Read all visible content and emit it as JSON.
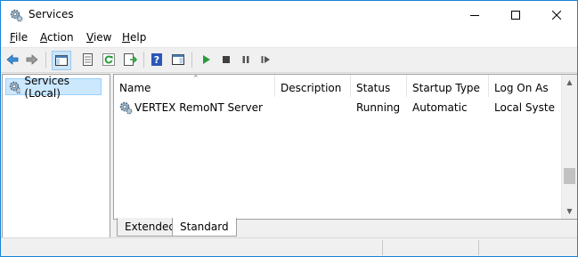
{
  "window": {
    "title": "Services"
  },
  "menu": [
    {
      "label": "File",
      "accel": "F",
      "rest": "ile"
    },
    {
      "label": "Action",
      "accel": "A",
      "rest": "ction"
    },
    {
      "label": "View",
      "accel": "V",
      "rest": "iew"
    },
    {
      "label": "Help",
      "accel": "H",
      "rest": "elp"
    }
  ],
  "toolbar": {
    "icons": [
      "back-icon",
      "forward-icon",
      "show-hide-console-tree-icon",
      "properties-icon",
      "refresh-icon",
      "export-list-icon",
      "help-icon",
      "show-action-pane-icon",
      "start-service-icon",
      "stop-service-icon",
      "pause-service-icon",
      "restart-service-icon"
    ]
  },
  "tree": {
    "root_label": "Services (Local)"
  },
  "list": {
    "columns": [
      "Name",
      "Description",
      "Status",
      "Startup Type",
      "Log On As"
    ],
    "rows": [
      {
        "name": "VERTEX RemoNT Server",
        "description": "",
        "status": "Running",
        "startup_type": "Automatic",
        "log_on_as": "Local Syste"
      }
    ]
  },
  "tabs": [
    "Extended",
    "Standard"
  ],
  "colors": {
    "selection": "#cce8ff",
    "accent": "#1883d7",
    "play_green": "#2a9d3a"
  }
}
